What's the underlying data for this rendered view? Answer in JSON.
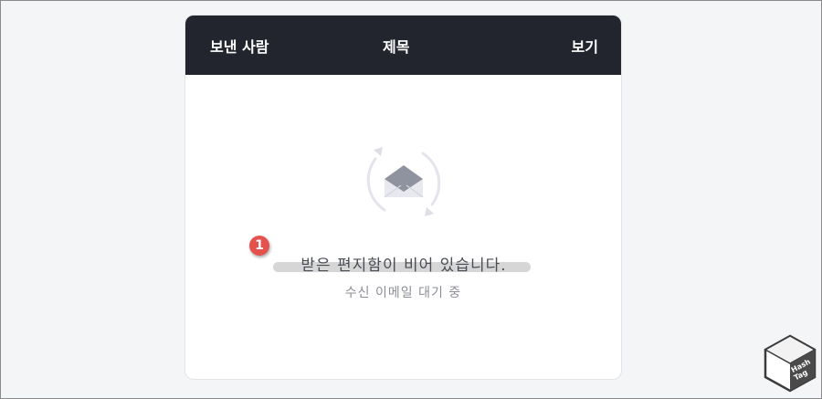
{
  "table_header": {
    "sender": "보낸 사람",
    "subject": "제목",
    "view": "보기"
  },
  "empty_state": {
    "icon": "envelope-refresh-icon",
    "title": "받은 편지함이 비어 있습니다.",
    "subtitle": "수신 이메일 대기 중"
  },
  "annotation": {
    "step": "1",
    "color": "#e4524e"
  },
  "logo": {
    "text_line1": "Hash",
    "text_line2": "Tag"
  },
  "colors": {
    "header_bg": "#22252e",
    "page_bg": "#f4f5f7",
    "card_bg": "#ffffff"
  }
}
